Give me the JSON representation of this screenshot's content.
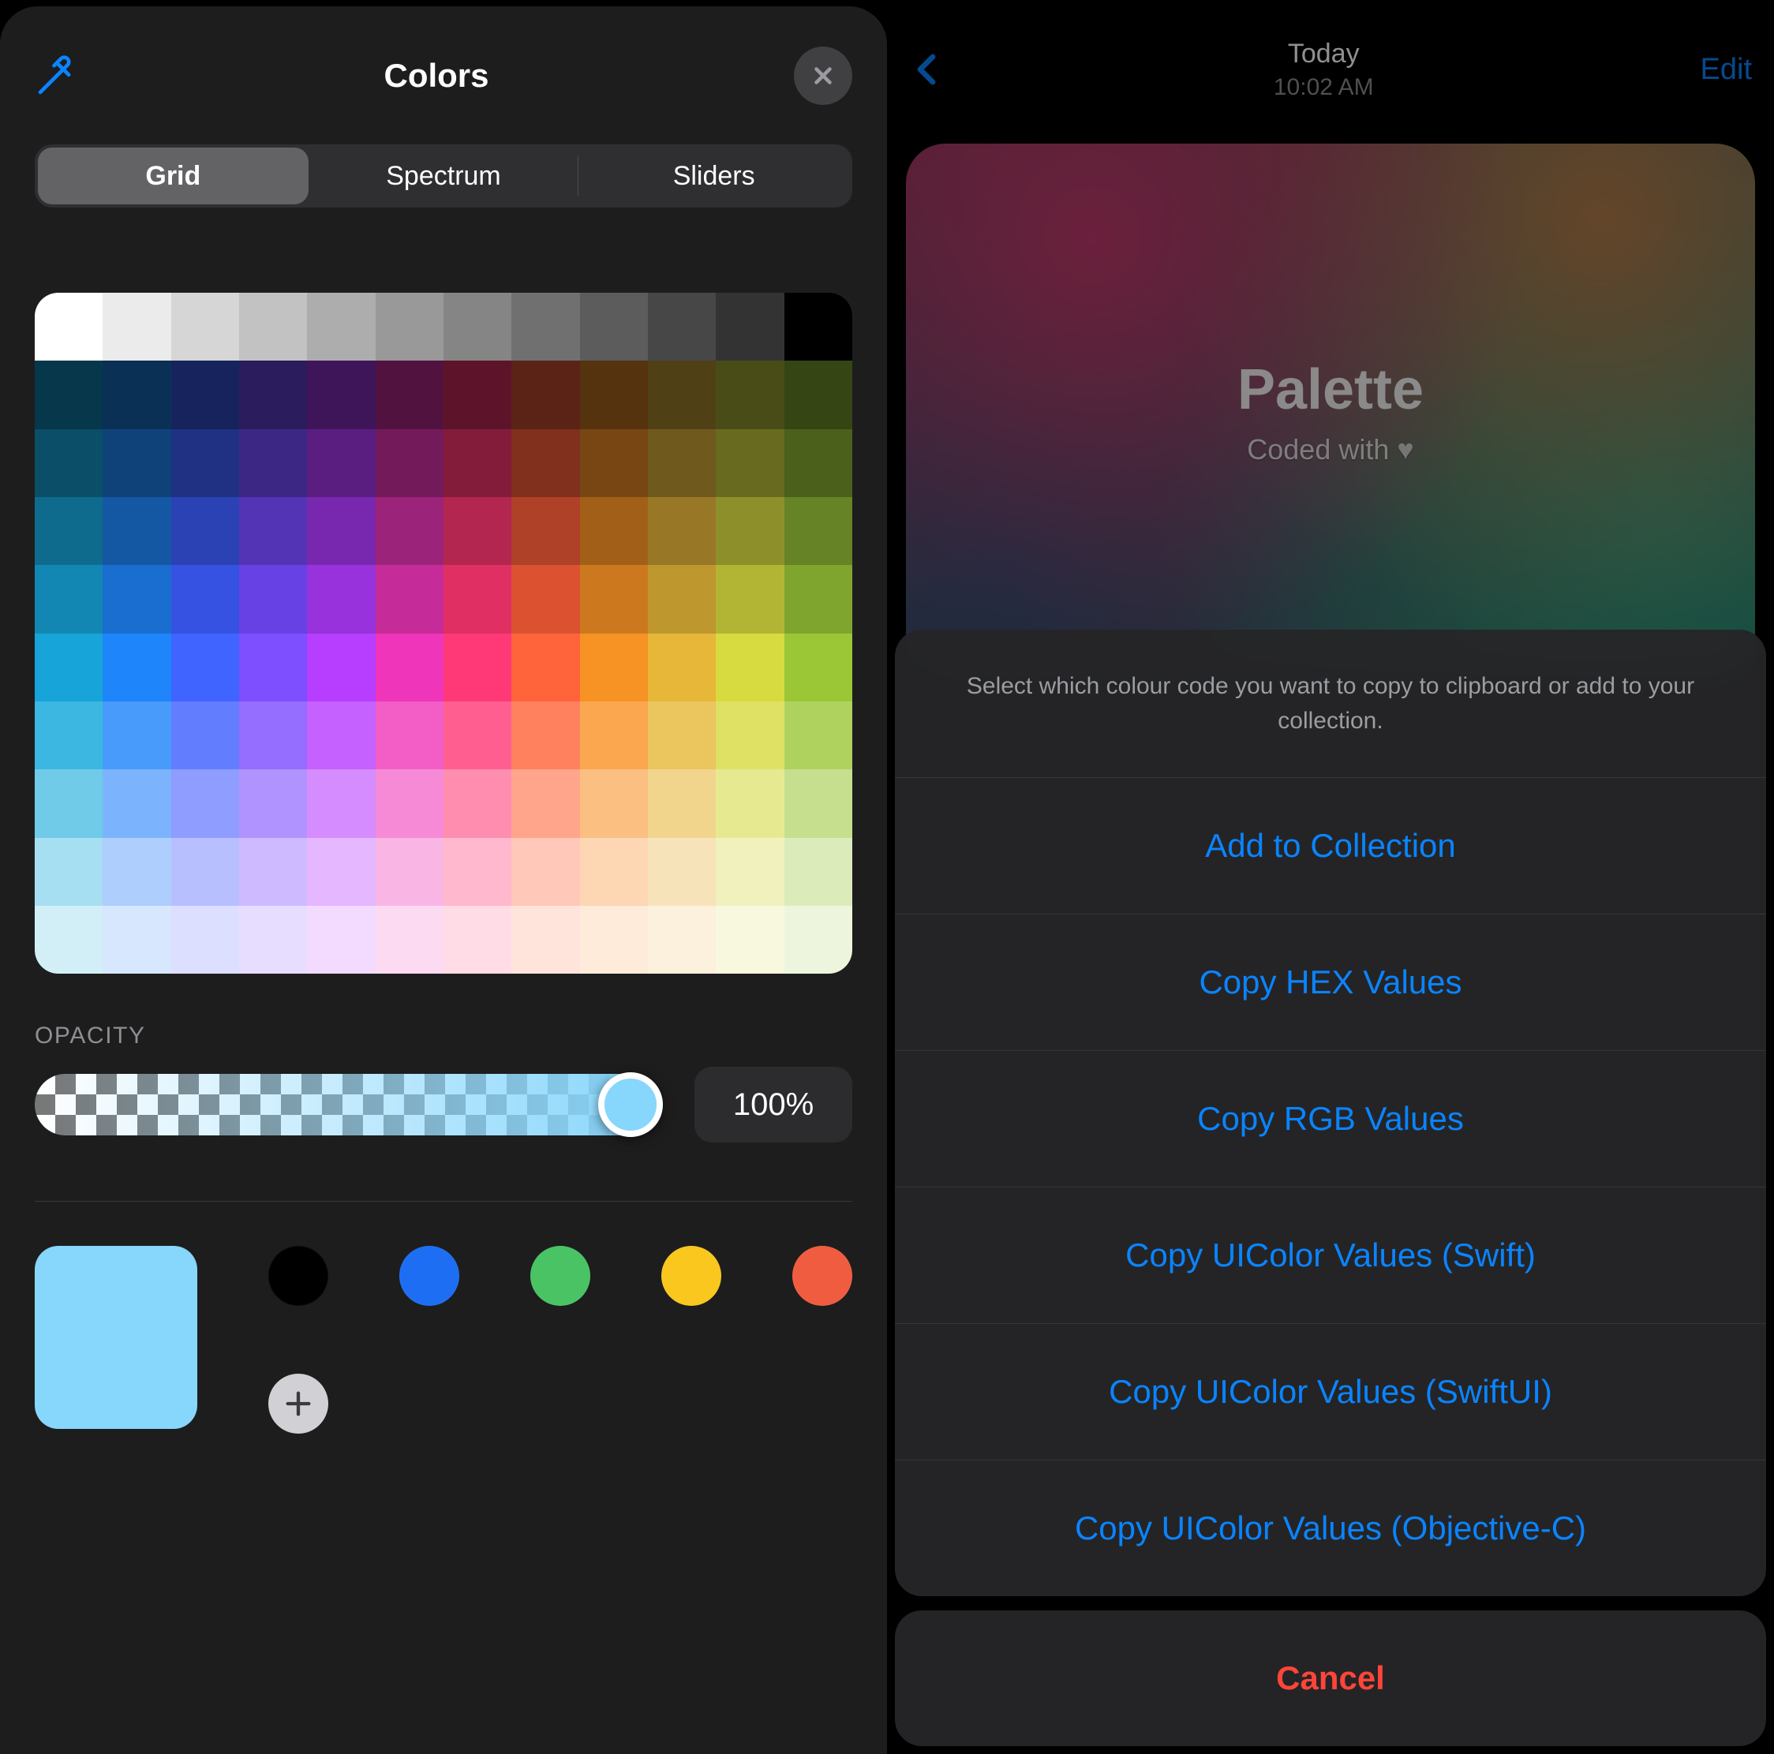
{
  "left": {
    "underlay_title": "Today",
    "title": "Colors",
    "tabs": [
      "Grid",
      "Spectrum",
      "Sliders"
    ],
    "selected_tab_index": 0,
    "opacity_label": "OPACITY",
    "opacity_value": "100%",
    "current_color": "#87d6fc",
    "recent_colors": [
      "#000000",
      "#1d6ef2",
      "#49c363",
      "#f9c71d",
      "#f05c3f"
    ],
    "grid_rows": [
      [
        "#ffffff",
        "#ebebeb",
        "#d6d6d6",
        "#c2c2c2",
        "#adadad",
        "#999999",
        "#858585",
        "#707070",
        "#5c5c5c",
        "#474747",
        "#333333",
        "#000000"
      ],
      [
        "#07374a",
        "#0b3056",
        "#17235c",
        "#2b1c5d",
        "#3f155a",
        "#521240",
        "#5d142a",
        "#5b2316",
        "#55330f",
        "#504016",
        "#4a4c17",
        "#364514"
      ],
      [
        "#0a4e68",
        "#0f4279",
        "#203184",
        "#3d2785",
        "#591e80",
        "#731a5a",
        "#821c3a",
        "#80301d",
        "#774612",
        "#70591c",
        "#686a1f",
        "#4b601b"
      ],
      [
        "#0f6b8e",
        "#1458a4",
        "#2b42b4",
        "#5234b5",
        "#7828ae",
        "#9c237a",
        "#b2264f",
        "#ae4127",
        "#a25f18",
        "#987826",
        "#8d902a",
        "#668325"
      ],
      [
        "#1387b3",
        "#196ecf",
        "#3552e2",
        "#6741e4",
        "#9732dc",
        "#c52c99",
        "#e02f63",
        "#dc5231",
        "#cc781e",
        "#be972f",
        "#b2b534",
        "#80a52e"
      ],
      [
        "#17a4d9",
        "#1e86fa",
        "#4064ff",
        "#7d4fff",
        "#b73dff",
        "#ef35b9",
        "#ff3978",
        "#ff643b",
        "#f79224",
        "#e6b738",
        "#d7db3f",
        "#9bc737"
      ],
      [
        "#3cb7e1",
        "#489afb",
        "#637dff",
        "#956dff",
        "#c561ff",
        "#f35ec6",
        "#ff5f90",
        "#ff815e",
        "#fba74f",
        "#ebc55e",
        "#dee164",
        "#afd25f"
      ],
      [
        "#70cbe9",
        "#7bb4fc",
        "#8e9dff",
        "#b193ff",
        "#d58cff",
        "#f68ad6",
        "#ff8daf",
        "#ffa58c",
        "#fcbf82",
        "#f1d58c",
        "#e7e991",
        "#c6df8e"
      ],
      [
        "#a6dff1",
        "#aecefd",
        "#b8bfff",
        "#cebaff",
        "#e4b7ff",
        "#f9b6e5",
        "#ffb8cd",
        "#ffc8b9",
        "#fdd7b3",
        "#f6e3b9",
        "#f0f1bd",
        "#dcebba"
      ],
      [
        "#d2eff8",
        "#d7e7fe",
        "#dcdfff",
        "#e7ddff",
        "#f2dbff",
        "#fcdbf2",
        "#ffdce6",
        "#ffe4dc",
        "#feebd9",
        "#fbf1dc",
        "#f8f8de",
        "#eef5dd"
      ]
    ]
  },
  "right": {
    "date": "Today",
    "time": "10:02 AM",
    "edit": "Edit",
    "card_title": "Palette",
    "card_sub_prefix": "Coded with ",
    "sheet_message": "Select which colour code you want to copy to clipboard or add to your collection.",
    "actions": [
      "Add to Collection",
      "Copy HEX Values",
      "Copy RGB Values",
      "Copy UIColor Values (Swift)",
      "Copy UIColor Values (SwiftUI)",
      "Copy UIColor Values (Objective-C)"
    ],
    "cancel": "Cancel"
  }
}
